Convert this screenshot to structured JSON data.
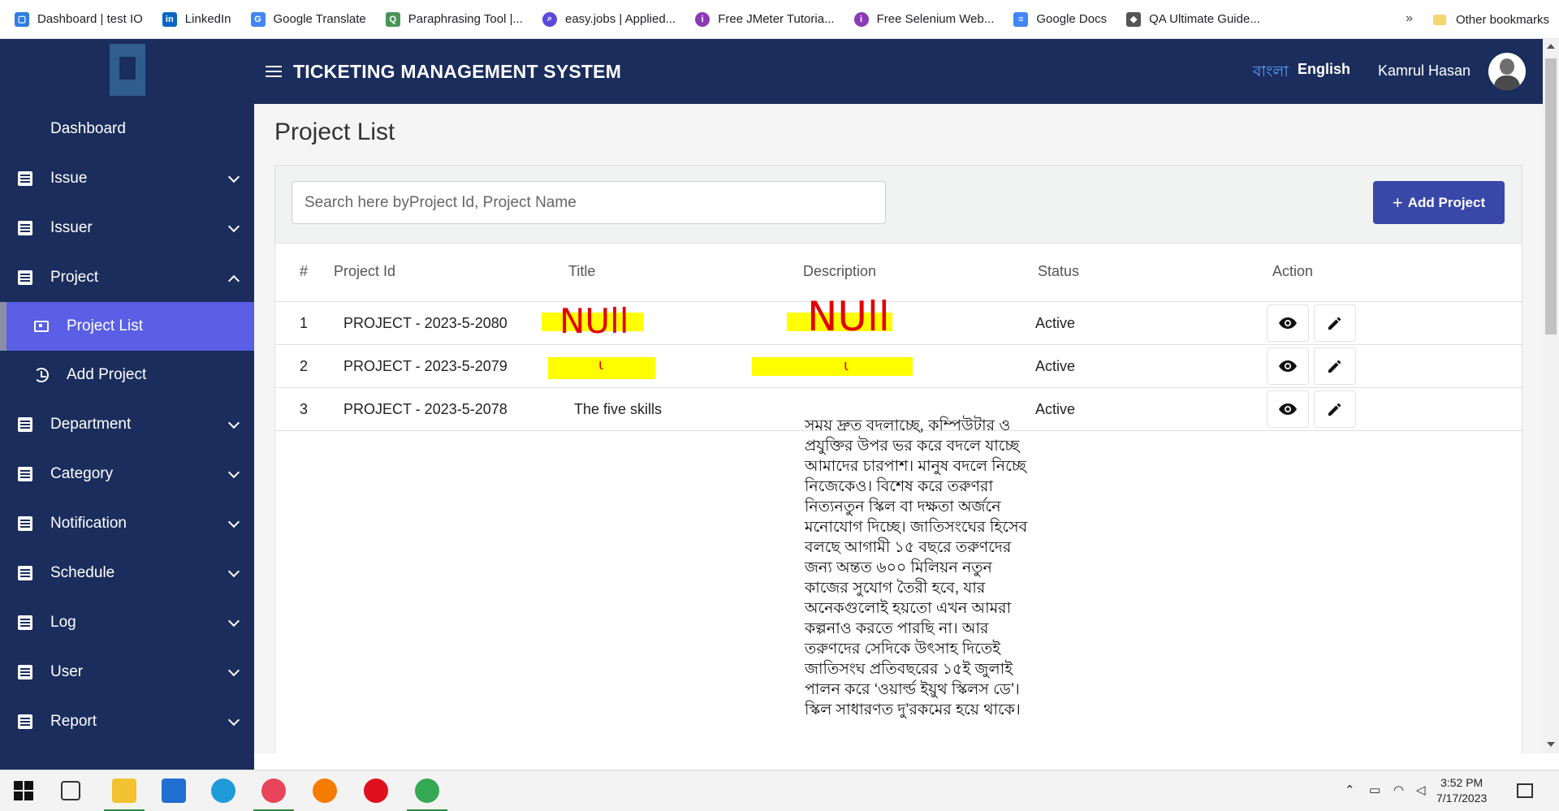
{
  "bookmarks": {
    "items": [
      {
        "label": "Dashboard | test IO",
        "icon": "testio-icon",
        "color": "#2f7de1"
      },
      {
        "label": "LinkedIn",
        "icon": "linkedin-icon",
        "color": "#0a66c2"
      },
      {
        "label": "Google Translate",
        "icon": "translate-icon",
        "color": "#4285f4"
      },
      {
        "label": "Paraphrasing Tool |...",
        "icon": "quillbot-icon",
        "color": "#499557"
      },
      {
        "label": "easy.jobs | Applied...",
        "icon": "easyjobs-icon",
        "color": "#5b4bdb"
      },
      {
        "label": "Free JMeter Tutoria...",
        "icon": "udemy-icon",
        "color": "#8c3ab8"
      },
      {
        "label": "Free Selenium Web...",
        "icon": "udemy-icon",
        "color": "#8c3ab8"
      },
      {
        "label": "Google Docs",
        "icon": "docs-icon",
        "color": "#4285f4"
      },
      {
        "label": "QA Ultimate Guide...",
        "icon": "guide-icon",
        "color": "#555555"
      }
    ],
    "more": "»",
    "other": "Other bookmarks"
  },
  "header": {
    "title": "TICKETING MANAGEMENT SYSTEM",
    "lang_bn": "বাংলা",
    "lang_en": "English",
    "user": "Kamrul Hasan"
  },
  "sidebar": {
    "items": [
      {
        "label": "Dashboard"
      },
      {
        "label": "Issue"
      },
      {
        "label": "Issuer"
      },
      {
        "label": "Project"
      },
      {
        "label": "Department"
      },
      {
        "label": "Category"
      },
      {
        "label": "Notification"
      },
      {
        "label": "Schedule"
      },
      {
        "label": "Log"
      },
      {
        "label": "User"
      },
      {
        "label": "Report"
      }
    ],
    "sub": {
      "project_list": "Project List",
      "add_project": "Add Project"
    }
  },
  "page": {
    "title": "Project List",
    "search_placeholder": "Search here byProject Id, Project Name",
    "add_button": "Add Project"
  },
  "table": {
    "headers": [
      "#",
      "Project Id",
      "Title",
      "Description",
      "Status",
      "Action"
    ],
    "rows": [
      {
        "num": "1",
        "id": "PROJECT - 2023-5-2080",
        "title": "",
        "description": "",
        "status": "Active"
      },
      {
        "num": "2",
        "id": "PROJECT - 2023-5-2079",
        "title": "",
        "description": "",
        "status": "Active"
      },
      {
        "num": "3",
        "id": "PROJECT - 2023-5-2078",
        "title": "The five skills",
        "description": "সময় দ্রুত বদলাচ্ছে, কম্পিউটার ও প্রযুক্তির উপর ভর করে বদলে যাচ্ছে আমাদের চারপাশ। মানুষ বদলে নিচ্ছে নিজেকেও। বিশেষ করে তরুণরা নিত্যনতুন স্কিল বা দক্ষতা অর্জনে মনোযোগ দিচ্ছে। জাতিসংঘের হিসেব বলছে আগামী ১৫ বছরে তরুণদের জন্য অন্তত ৬০০ মিলিয়ন নতুন কাজের সুযোগ তৈরী হবে, যার অনেকগুলোই হয়তো এখন আমরা কল্পনাও করতে পারছি না। আর তরুণদের সেদিকে উৎসাহ দিতেই জাতিসংঘ প্রতিবছরের ১৫ই জুলাই পালন করে ‘ওয়ার্ল্ড ইয়ুথ স্কিলস ডে’। স্কিল সাধারণত দু’রকমের হয়ে থাকে।",
        "status": "Active"
      }
    ],
    "annotation": "NUll"
  },
  "taskbar": {
    "time": "3:52 PM",
    "date": "7/17/2023"
  },
  "colors": {
    "navy": "#1a2d5c",
    "active": "#5a5fe6",
    "button": "#3847a8",
    "highlight": "#ffff00",
    "scribble": "#e00000"
  }
}
